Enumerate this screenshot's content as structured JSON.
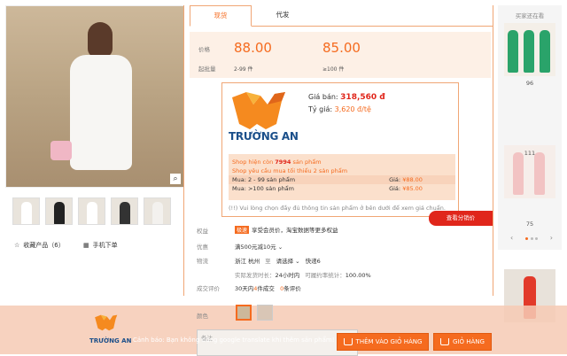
{
  "gallery": {
    "fav_label": "收藏产品（6）",
    "mobile_label": "手机下单"
  },
  "tabs": [
    {
      "label": "现货"
    },
    {
      "label": "代发"
    }
  ],
  "pricing": {
    "price_label": "价格",
    "qty_label": "起批量",
    "tier1_price": "88.00",
    "tier1_qty": "2-99 件",
    "tier2_price": "85.00",
    "tier2_qty": "≥100 件"
  },
  "truong_an": {
    "brand": "TRƯỜNG AN",
    "price_label": "Giá bán:",
    "price_value": "318,560 đ",
    "rate_label": "Tỷ giá:",
    "rate_value": "3,620 đ/tệ",
    "stock_prefix": "Shop hiện còn",
    "stock_count": "7994",
    "stock_suffix": "sản phẩm",
    "min_order": "Shop yêu cầu mua tối thiểu 2 sản phẩm",
    "tier1_label": "Mua: 2 - 99 sản phẩm",
    "tier1_price_label": "Giá:",
    "tier1_price": "¥88.00",
    "tier2_label": "Mua: >100 sản phẩm",
    "tier2_price_label": "Giá:",
    "tier2_price": "¥85.00",
    "note": "(!!) Vui lòng chọn đầy đủ thông tin sản phẩm ở bên dưới để xem giá chuẩn."
  },
  "rate_button": "查看分销价",
  "attrs": {
    "rights_label": "权益",
    "rights_badge": "极速",
    "rights_value": "享受会员价，淘宝数据等更多权益",
    "discount_label": "优惠",
    "discount_value": "满500元减10元",
    "logistics_label": "物流",
    "origin": "浙江 杭州",
    "to": "至",
    "dest": "请选择",
    "shipping": "快递6",
    "ship_time": "实际发货时长：",
    "ship_time_val": "24小时内",
    "ship_rate": "可履约率统计：",
    "ship_rate_val": "100.00%",
    "sales_label": "成交评价",
    "sales_pre": "30天内",
    "sales_count": "4",
    "sales_mid": "件成交",
    "reviews_count": "0",
    "reviews_suffix": "条评价",
    "color_label": "颜色",
    "memo_label": "备注"
  },
  "sidebar": {
    "title": "买家还在看",
    "items": [
      {
        "count": "96"
      },
      {
        "count": "111"
      },
      {
        "count": "75"
      }
    ]
  },
  "bottom_bar": {
    "brand": "TRƯỜNG AN",
    "warning": "Cảnh báo: Bạn không dùng google translate khi thêm sản phẩm!",
    "add_to_cart": "THÊM VÀO GIỎ HÀNG",
    "cart": "GIỎ HÀNG"
  },
  "colors": {
    "accent": "#f56b1f",
    "price_red": "#e0261b",
    "brand_blue": "#1b4f8a"
  }
}
